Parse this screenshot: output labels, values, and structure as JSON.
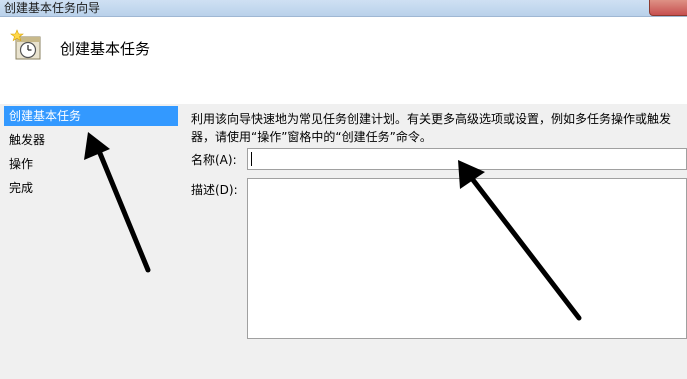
{
  "window": {
    "title": "创建基本任务向导"
  },
  "header": {
    "title": "创建基本任务",
    "icon": "task-scheduler-clock-icon"
  },
  "sidebar": {
    "items": [
      {
        "label": "创建基本任务",
        "active": true
      },
      {
        "label": "触发器",
        "active": false
      },
      {
        "label": "操作",
        "active": false
      },
      {
        "label": "完成",
        "active": false
      }
    ]
  },
  "main": {
    "description": "利用该向导快速地为常见任务创建计划。有关更多高级选项或设置，例如多任务操作或触发器，请使用“操作”窗格中的“创建任务”命令。",
    "name_label": "名称(A):",
    "name_value": "",
    "description_label": "描述(D):",
    "description_value": ""
  },
  "colors": {
    "selection": "#3399ff",
    "annotation_arrow": "#000000"
  }
}
